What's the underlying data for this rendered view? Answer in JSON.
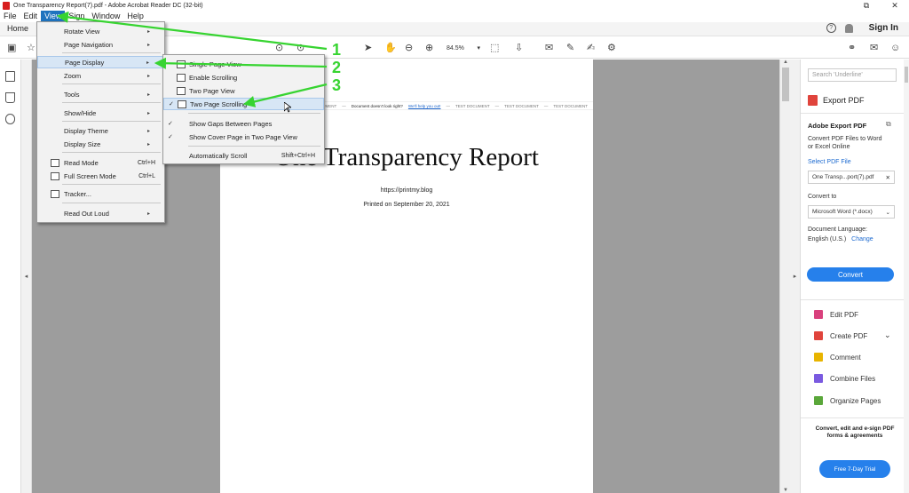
{
  "window": {
    "title": "One Transparency Report(7).pdf - Adobe Acrobat Reader DC (32-bit)",
    "controls": [
      "⧉",
      "✕"
    ]
  },
  "menubar": [
    "File",
    "Edit",
    "View",
    "Sign",
    "Window",
    "Help"
  ],
  "tabbar": {
    "home": "Home",
    "help": "?",
    "sign_in": "Sign In"
  },
  "toolbar": {
    "zoom": "84.5%"
  },
  "view_menu": [
    {
      "label": "Rotate View",
      "arrow": "▸"
    },
    {
      "label": "Page Navigation",
      "arrow": "▸"
    },
    {
      "label": "Page Display",
      "arrow": "▸"
    },
    {
      "label": "Zoom",
      "arrow": "▸"
    },
    {
      "label": "Tools",
      "arrow": "▸"
    },
    {
      "label": "Show/Hide",
      "arrow": "▸"
    },
    {
      "label": "Display Theme",
      "arrow": "▸"
    },
    {
      "label": "Display Size",
      "arrow": "▸"
    },
    {
      "label": "Read Mode",
      "shortcut": "Ctrl+H"
    },
    {
      "label": "Full Screen Mode",
      "shortcut": "Ctrl+L"
    },
    {
      "label": "Tracker..."
    },
    {
      "label": "Read Out Loud",
      "arrow": "▸"
    }
  ],
  "page_display_menu": [
    {
      "label": "Single Page View"
    },
    {
      "label": "Enable Scrolling"
    },
    {
      "label": "Two Page View"
    },
    {
      "label": "Two Page Scrolling",
      "check": "✓"
    },
    {
      "label": "Show Gaps Between Pages",
      "check": "✓"
    },
    {
      "label": "Show Cover Page in Two Page View",
      "check": "✓"
    },
    {
      "label": "Automatically Scroll",
      "shortcut": "Shift+Ctrl+H"
    }
  ],
  "document": {
    "banner_a": "TEST DOCUMENT",
    "banner_b": "Document doesn't look right?",
    "banner_link": "We'll help you out!",
    "banner_c": "TEST DOCUMENT",
    "banner_d": "TEST DOCUMENT",
    "banner_e": "TEST DOCUMENT",
    "title": "One Transparency Report",
    "url": "https://printmy.blog",
    "printed": "Printed on September 20, 2021"
  },
  "right_panel": {
    "search_placeholder": "Search 'Underline'",
    "export_title": "Export PDF",
    "adobe_export": "Adobe Export PDF",
    "desc": "Convert PDF Files to Word or Excel Online",
    "select_file": "Select PDF File",
    "file_name": "One Transp...port(7).pdf",
    "convert_to": "Convert to",
    "format": "Microsoft Word (*.docx)",
    "doc_lang": "Document Language:",
    "lang": "English (U.S.)",
    "change": "Change",
    "convert_btn": "Convert",
    "tools": [
      {
        "label": "Edit PDF",
        "color": "#d9417d"
      },
      {
        "label": "Create PDF",
        "color": "#e0443c"
      },
      {
        "label": "Comment",
        "color": "#e8b400"
      },
      {
        "label": "Combine Files",
        "color": "#7a5ae0"
      },
      {
        "label": "Organize Pages",
        "color": "#5aa73a"
      }
    ],
    "footer_1": "Convert, edit and e-sign PDF",
    "footer_2": "forms & agreements",
    "trial": "Free 7-Day Trial"
  },
  "annotations": {
    "color": "#37d431",
    "labels": [
      "1",
      "2",
      "3"
    ]
  }
}
